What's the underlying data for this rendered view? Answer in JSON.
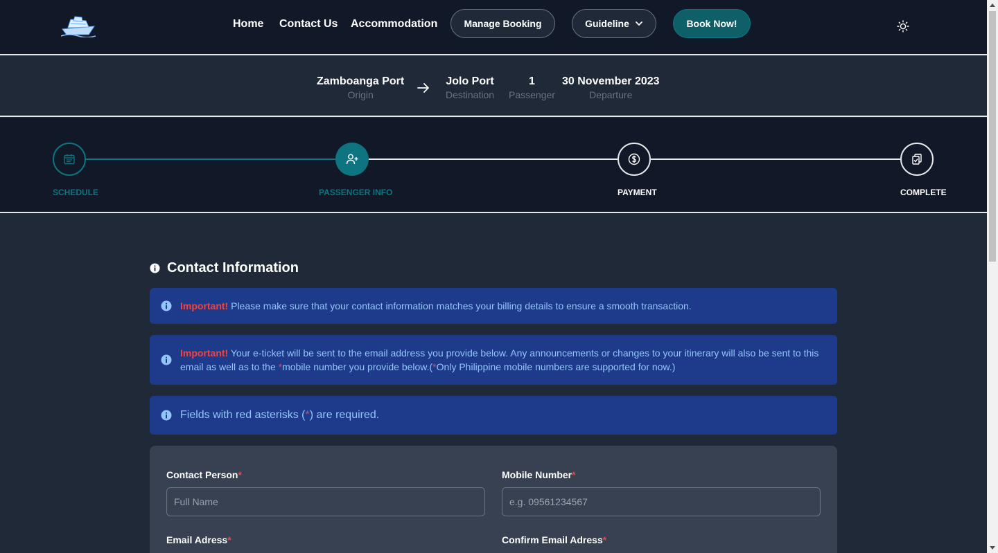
{
  "nav": {
    "home": "Home",
    "contact": "Contact Us",
    "accommodation": "Accommodation",
    "manage_booking": "Manage Booking",
    "guideline": "Guideline",
    "book_now": "Book Now!"
  },
  "trip": {
    "origin_value": "Zamboanga Port",
    "origin_label": "Origin",
    "destination_value": "Jolo Port",
    "destination_label": "Destination",
    "passenger_value": "1",
    "passenger_label": "Passenger",
    "departure_value": "30 November 2023",
    "departure_label": "Departure"
  },
  "steps": [
    {
      "label": "SCHEDULE",
      "state": "done"
    },
    {
      "label": "PASSENGER INFO",
      "state": "active"
    },
    {
      "label": "PAYMENT",
      "state": "pending"
    },
    {
      "label": "COMPLETE",
      "state": "pending"
    }
  ],
  "section": {
    "title": "Contact Information"
  },
  "alerts": {
    "a1_important": "Important!",
    "a1_text": " Please make sure that your contact information matches your billing details to ensure a smooth transaction.",
    "a2_important": "Important!",
    "a2_text_1": " Your e-ticket will be sent to the email address you provide below. Any announcements or changes to your itinerary will also be sent to this email as well as to the ",
    "a2_asterisk_1": "*",
    "a2_text_2": "mobile number you provide below.(",
    "a2_asterisk_2": "*",
    "a2_text_3": "Only Philippine mobile numbers are supported for now.)",
    "a3_text_1": "Fields with red asterisks (",
    "a3_asterisk": "*",
    "a3_text_2": ") are required."
  },
  "form": {
    "contact_person_label": "Contact Person",
    "contact_person_placeholder": "Full Name",
    "mobile_label": "Mobile Number",
    "mobile_placeholder": "e.g. 09561234567",
    "email_label": "Email Adress",
    "confirm_email_label": "Confirm Email Adress",
    "required_mark": "*"
  },
  "colors": {
    "navbar_bg": "#111827",
    "page_bg": "#1f2937",
    "accent_teal": "#0e7480",
    "alert_bg": "#1e3a8a",
    "alert_text": "#93c5fd",
    "important_red": "#ef4444"
  }
}
